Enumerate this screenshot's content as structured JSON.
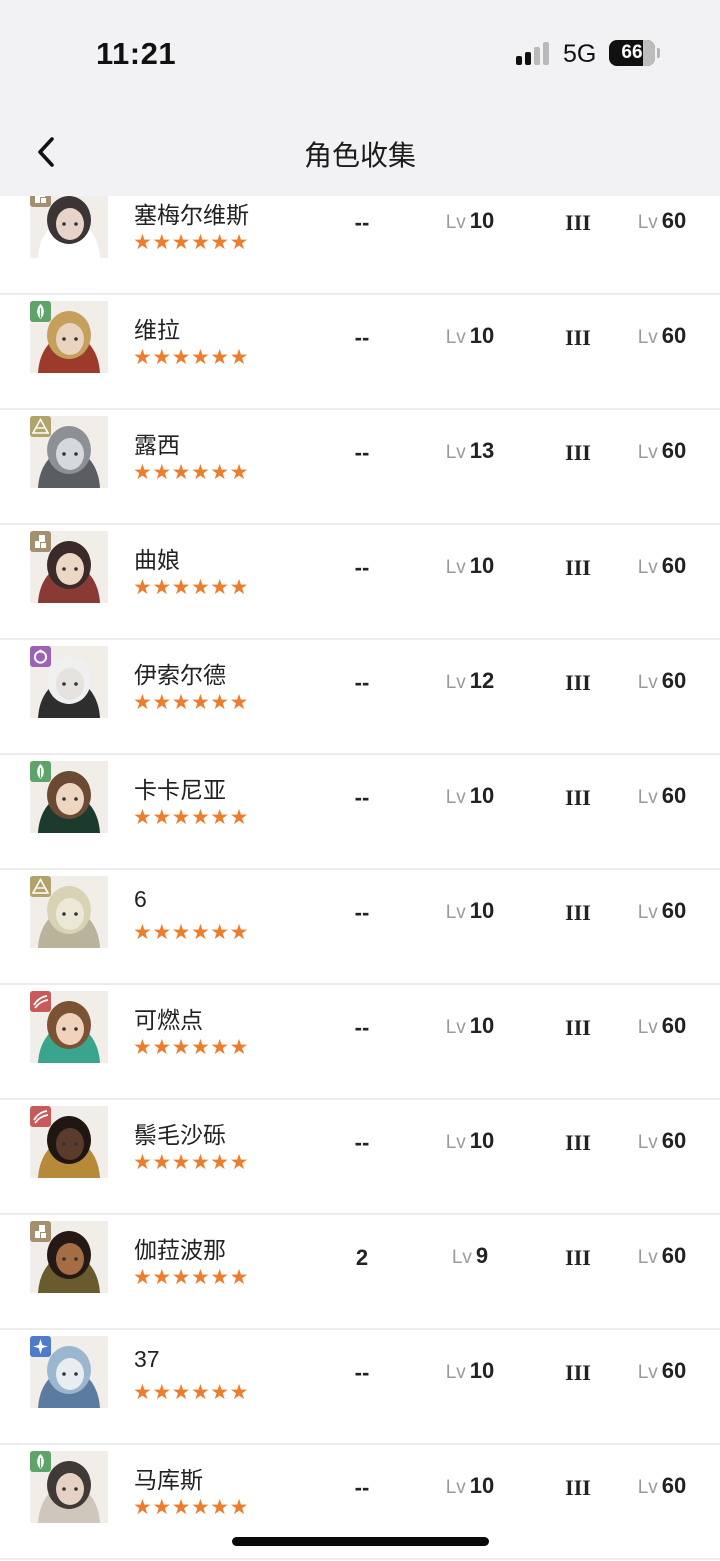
{
  "status_bar": {
    "time": "11:21",
    "network": "5G",
    "battery": "66"
  },
  "nav": {
    "title": "角色收集",
    "back_icon": "chevron-left-icon"
  },
  "columns_hint": [
    "name",
    "duplicates",
    "level",
    "rank",
    "max_level"
  ],
  "characters": [
    {
      "name": "塞梅尔维斯",
      "stars": "★★★★★★",
      "element": "tower-icon",
      "element_color": "#a3906e",
      "dup": "--",
      "lv_prefix": "Lv",
      "level": "10",
      "rank": "III",
      "max_prefix": "Lv",
      "max_level": "60"
    },
    {
      "name": "维拉",
      "stars": "★★★★★★",
      "element": "leaf-icon",
      "element_color": "#5fa36b",
      "dup": "--",
      "lv_prefix": "Lv",
      "level": "10",
      "rank": "III",
      "max_prefix": "Lv",
      "max_level": "60"
    },
    {
      "name": "露西",
      "stars": "★★★★★★",
      "element": "pyramid-icon",
      "element_color": "#b2a36c",
      "dup": "--",
      "lv_prefix": "Lv",
      "level": "13",
      "rank": "III",
      "max_prefix": "Lv",
      "max_level": "60"
    },
    {
      "name": "曲娘",
      "stars": "★★★★★★",
      "element": "tower-icon",
      "element_color": "#a3906e",
      "dup": "--",
      "lv_prefix": "Lv",
      "level": "10",
      "rank": "III",
      "max_prefix": "Lv",
      "max_level": "60"
    },
    {
      "name": "伊索尔德",
      "stars": "★★★★★★",
      "element": "ring-icon",
      "element_color": "#9b62b5",
      "dup": "--",
      "lv_prefix": "Lv",
      "level": "12",
      "rank": "III",
      "max_prefix": "Lv",
      "max_level": "60"
    },
    {
      "name": "卡卡尼亚",
      "stars": "★★★★★★",
      "element": "leaf-icon",
      "element_color": "#5fa36b",
      "dup": "--",
      "lv_prefix": "Lv",
      "level": "10",
      "rank": "III",
      "max_prefix": "Lv",
      "max_level": "60"
    },
    {
      "name": "6",
      "stars": "★★★★★★",
      "element": "pyramid-icon",
      "element_color": "#b2a36c",
      "dup": "--",
      "lv_prefix": "Lv",
      "level": "10",
      "rank": "III",
      "max_prefix": "Lv",
      "max_level": "60"
    },
    {
      "name": "可燃点",
      "stars": "★★★★★★",
      "element": "claw-icon",
      "element_color": "#c95a5a",
      "dup": "--",
      "lv_prefix": "Lv",
      "level": "10",
      "rank": "III",
      "max_prefix": "Lv",
      "max_level": "60"
    },
    {
      "name": "鬃毛沙砾",
      "stars": "★★★★★★",
      "element": "claw-icon",
      "element_color": "#c95a5a",
      "dup": "--",
      "lv_prefix": "Lv",
      "level": "10",
      "rank": "III",
      "max_prefix": "Lv",
      "max_level": "60"
    },
    {
      "name": "伽菈波那",
      "stars": "★★★★★★",
      "element": "tower-icon",
      "element_color": "#a3906e",
      "dup": "2",
      "lv_prefix": "Lv",
      "level": "9",
      "rank": "III",
      "max_prefix": "Lv",
      "max_level": "60"
    },
    {
      "name": "37",
      "stars": "★★★★★★",
      "element": "star-icon",
      "element_color": "#4d7cc9",
      "dup": "--",
      "lv_prefix": "Lv",
      "level": "10",
      "rank": "III",
      "max_prefix": "Lv",
      "max_level": "60"
    },
    {
      "name": "马库斯",
      "stars": "★★★★★★",
      "element": "leaf-icon",
      "element_color": "#5fa36b",
      "dup": "--",
      "lv_prefix": "Lv",
      "level": "10",
      "rank": "III",
      "max_prefix": "Lv",
      "max_level": "60"
    }
  ]
}
